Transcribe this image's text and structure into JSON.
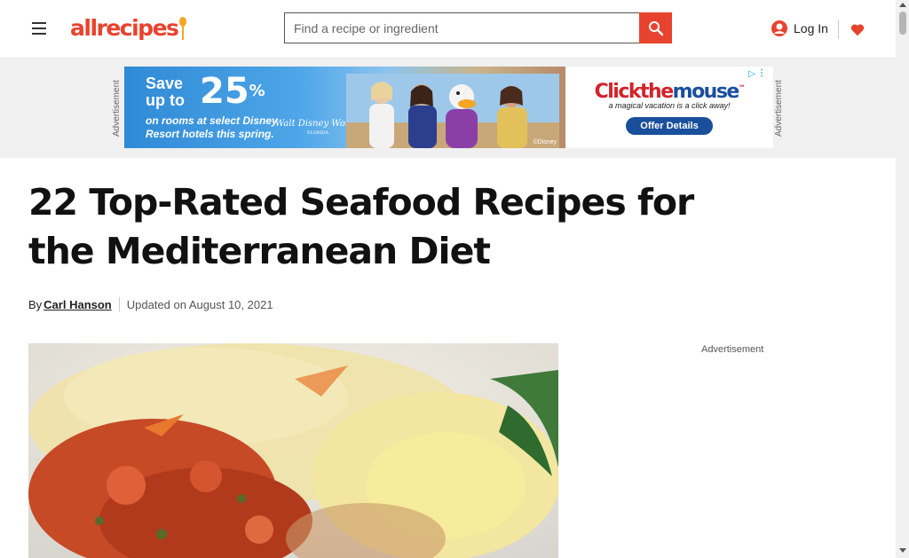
{
  "header": {
    "logo_text": "allrecipes",
    "search_placeholder": "Find a recipe or ingredient",
    "login_label": "Log In",
    "brand_color": "#e8432e",
    "icons": [
      "menu-icon",
      "search-icon",
      "user-icon",
      "heart-icon"
    ]
  },
  "ad": {
    "side_label": "Advertisement",
    "save_text": "Save up to",
    "percent": "25",
    "percent_sign": "%",
    "subtext_line1": "on rooms at select Disney",
    "subtext_line2": "Resort hotels this spring.",
    "wdw_text": "Walt Disney World",
    "wdw_sub": "FLORIDA",
    "disney_mark": "©Disney",
    "brand_part1": "Click",
    "brand_part2": "the",
    "brand_part3": "mouse",
    "brand_tm": "™",
    "tagline": "a magical vacation is a click away!",
    "cta": "Offer Details"
  },
  "article": {
    "title": "22 Top-Rated Seafood Recipes for the Mediterranean Diet",
    "by_prefix": "By",
    "author": "Carl Hanson",
    "updated": "Updated on August 10, 2021"
  },
  "sidebar": {
    "ad_label": "Advertisement"
  }
}
